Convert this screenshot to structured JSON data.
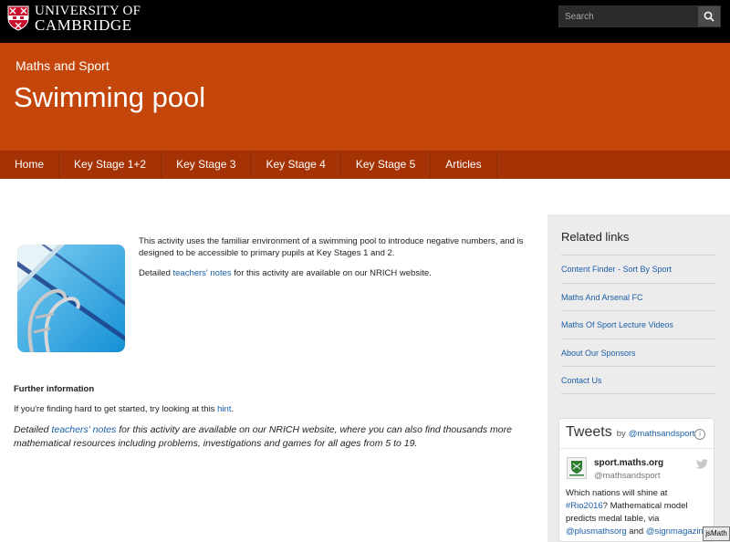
{
  "header": {
    "logo_line1": "UNIVERSITY OF",
    "logo_line2": "CAMBRIDGE",
    "search_placeholder": "Search"
  },
  "banner": {
    "subtitle": "Maths and Sport",
    "title": "Swimming pool"
  },
  "nav": {
    "items": [
      "Home",
      "Key Stage 1+2",
      "Key Stage 3",
      "Key Stage 4",
      "Key Stage 5",
      "Articles"
    ]
  },
  "main": {
    "intro_p1": "This activity uses the familiar environment of a swimming pool to introduce negative numbers, and is designed to be accessible to primary pupils at Key Stages 1 and 2.",
    "intro_p2_prefix": "Detailed ",
    "intro_p2_link": "teachers' notes",
    "intro_p2_suffix": " for this activity are available on our NRICH website.",
    "further_heading": "Further information",
    "hint_prefix": "If you're finding hard to get started, try looking at this ",
    "hint_link": "hint",
    "hint_suffix": ".",
    "detail_prefix": "Detailed ",
    "detail_link": "teachers' notes",
    "detail_suffix": " for this activity are available on our NRICH website, where you can also find thousands more mathematical resources including problems, investigations and games for all ages from 5 to 19."
  },
  "sidebar": {
    "heading": "Related links",
    "links": [
      "Content Finder - Sort By Sport",
      "Maths And Arsenal FC",
      "Maths Of Sport Lecture Videos",
      "About Our Sponsors",
      "Contact Us"
    ]
  },
  "tweets": {
    "title": "Tweets",
    "by": "by",
    "handle": "@mathsandsport",
    "account_name": "sport.maths.org",
    "account_handle": "@mathsandsport",
    "text_1": "Which nations will shine at ",
    "hashtag": "#Rio2016",
    "text_2": "? Mathematical model predicts medal table, via ",
    "mention_1": "@plusmathsorg",
    "text_3": " and ",
    "mention_2": "@signmagazine"
  },
  "jsmath_label": "jsMath",
  "colors": {
    "banner": "#c5460a",
    "nav": "#a43204",
    "link": "#1a5ea8"
  }
}
